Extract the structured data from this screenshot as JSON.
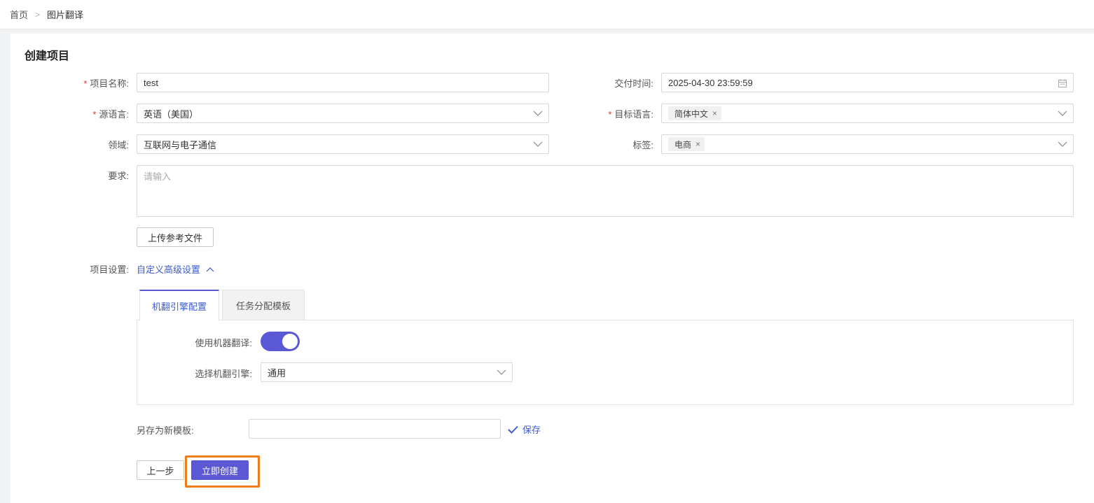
{
  "breadcrumb": {
    "home": "首页",
    "separator": ">",
    "current": "图片翻译"
  },
  "page_title": "创建项目",
  "form": {
    "project_name": {
      "label": "项目名称:",
      "required": "*",
      "value": "test"
    },
    "delivery_time": {
      "label": "交付时间:",
      "value": "2025-04-30 23:59:59",
      "icon": "calendar-icon"
    },
    "source_language": {
      "label": "源语言:",
      "required": "*",
      "value": "英语（美国）"
    },
    "target_language": {
      "label": "目标语言:",
      "required": "*",
      "tags": [
        "简体中文"
      ]
    },
    "domain": {
      "label": "领域:",
      "value": "互联网与电子通信"
    },
    "tags": {
      "label": "标签:",
      "tags": [
        "电商"
      ]
    },
    "requirement": {
      "label": "要求:",
      "placeholder": "请输入"
    },
    "upload_button": "上传参考文件",
    "project_settings": {
      "label": "项目设置:",
      "link": "自定义高级设置"
    }
  },
  "tag_remove": "×",
  "tabs": [
    {
      "label": "机翻引擎配置",
      "active": true
    },
    {
      "label": "任务分配模板",
      "active": false
    }
  ],
  "mt_config": {
    "use_mt_label": "使用机器翻译:",
    "use_mt_enabled": true,
    "engine_label": "选择机翻引擎:",
    "engine_value": "通用"
  },
  "save_template": {
    "label": "另存为新模板:",
    "value": "",
    "save_link": "保存"
  },
  "actions": {
    "prev": "上一步",
    "create": "立即创建"
  },
  "colors": {
    "primary": "#5b58d6",
    "link": "#3a5bd1",
    "required": "#e5322d",
    "highlight": "#f07d1b"
  }
}
